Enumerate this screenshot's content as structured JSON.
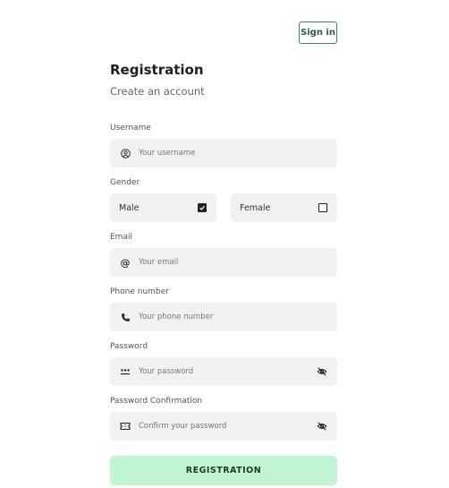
{
  "header": {
    "signin_label": "Sign in"
  },
  "form": {
    "title": "Registration",
    "subtitle": "Create an account",
    "username": {
      "label": "Username",
      "placeholder": "Your username",
      "icon": "user-circle-icon"
    },
    "gender": {
      "label": "Gender",
      "options": [
        {
          "label": "Male",
          "checked": true
        },
        {
          "label": "Female",
          "checked": false
        }
      ]
    },
    "email": {
      "label": "Email",
      "placeholder": "Your email",
      "icon": "at-icon"
    },
    "phone": {
      "label": "Phone number",
      "placeholder": "Your phone number",
      "icon": "phone-icon"
    },
    "password": {
      "label": "Password",
      "placeholder": "Your password",
      "icon": "password-dots-icon"
    },
    "password_confirm": {
      "label": "Password Confirmation",
      "placeholder": "Confirm your password",
      "icon": "ticket-icon"
    },
    "submit_label": "REGISTRATION"
  }
}
